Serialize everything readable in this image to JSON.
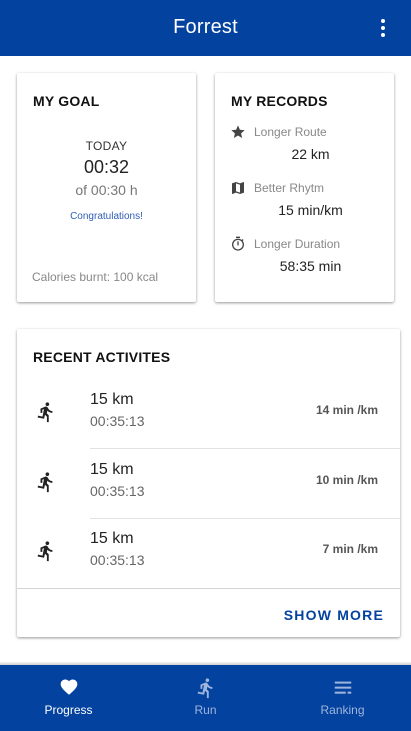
{
  "app": {
    "title": "Forrest"
  },
  "goal": {
    "title": "MY GOAL",
    "today_label": "TODAY",
    "time": "00:32",
    "target": "of 00:30 h",
    "message": "Congratulations!",
    "calories": "Calories burnt: 100 kcal"
  },
  "records": {
    "title": "MY RECORDS",
    "items": [
      {
        "icon": "star-icon",
        "label": "Longer Route",
        "value": "22 km"
      },
      {
        "icon": "map-icon",
        "label": "Better Rhytm",
        "value": "15 min/km"
      },
      {
        "icon": "timer-icon",
        "label": "Longer Duration",
        "value": "58:35 min"
      }
    ]
  },
  "recent": {
    "title": "RECENT ACTIVITES",
    "activities": [
      {
        "icon": "runner-icon",
        "distance": "15 km",
        "duration": "00:35:13",
        "pace": "14 min /km"
      },
      {
        "icon": "runner-icon",
        "distance": "15 km",
        "duration": "00:35:13",
        "pace": "10 min /km"
      },
      {
        "icon": "runner-icon",
        "distance": "15 km",
        "duration": "00:35:13",
        "pace": "7 min /km"
      }
    ],
    "show_more": "SHOW MORE"
  },
  "nav": {
    "items": [
      {
        "icon": "heart-icon",
        "label": "Progress",
        "active": true
      },
      {
        "icon": "runner-icon",
        "label": "Run",
        "active": false
      },
      {
        "icon": "ranking-icon",
        "label": "Ranking",
        "active": false
      }
    ]
  },
  "colors": {
    "primary": "#03429f",
    "accent_text": "#2f5fb6",
    "inactive_nav": "#9fb5db"
  }
}
